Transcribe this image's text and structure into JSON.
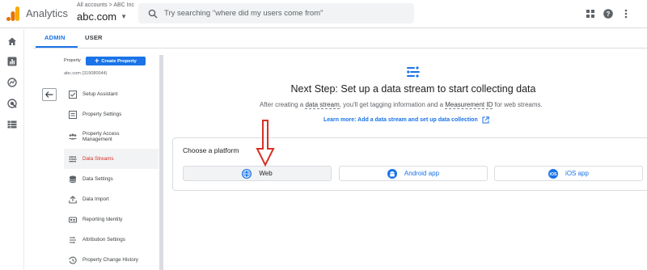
{
  "header": {
    "app_name": "Analytics",
    "account_crumb": "All accounts > ABC Inc",
    "property_name": "abc.com",
    "search_placeholder": "Try searching \"where did my users come from\"",
    "icons": [
      "apps-grid-icon",
      "help-icon",
      "more-vert-icon"
    ]
  },
  "rail": {
    "icons": [
      "home-icon",
      "reports-icon",
      "explore-icon",
      "advertising-icon",
      "configure-icon"
    ]
  },
  "tabs": [
    {
      "label": "ADMIN",
      "active": true
    },
    {
      "label": "USER",
      "active": false
    }
  ],
  "admin": {
    "column_label": "Property",
    "create_button": "Create Property",
    "property_id": "abc.com (319080044)",
    "nav": [
      {
        "label": "Setup Assistant",
        "icon": "checklist-icon"
      },
      {
        "label": "Property Settings",
        "icon": "settings-box-icon"
      },
      {
        "label": "Property Access Management",
        "icon": "people-icon"
      },
      {
        "label": "Data Streams",
        "icon": "streams-icon",
        "active": true
      },
      {
        "label": "Data Settings",
        "icon": "database-icon"
      },
      {
        "label": "Data Import",
        "icon": "upload-icon"
      },
      {
        "label": "Reporting Identity",
        "icon": "identity-icon"
      },
      {
        "label": "Attribution Settings",
        "icon": "attribution-icon"
      },
      {
        "label": "Property Change History",
        "icon": "history-icon"
      }
    ]
  },
  "main": {
    "headline": "Next Step: Set up a data stream to start collecting data",
    "sub_before": "After creating a ",
    "sub_term1": "data stream",
    "sub_middle": ", you'll get tagging information and a ",
    "sub_term2": "Measurement ID",
    "sub_after": " for web streams.",
    "learn_more": "Learn more: Add a data stream and set up data collection",
    "choose_platform": "Choose a platform",
    "platforms": [
      {
        "label": "Web",
        "icon": "globe-icon"
      },
      {
        "label": "Android app",
        "icon": "android-icon"
      },
      {
        "label": "iOS app",
        "icon": "ios-icon"
      }
    ]
  },
  "colors": {
    "accent": "#1a73e8",
    "active_nav_text": "#d93025",
    "annotation_arrow": "#d93025",
    "logo": [
      "#f9ab00",
      "#e37400"
    ]
  }
}
